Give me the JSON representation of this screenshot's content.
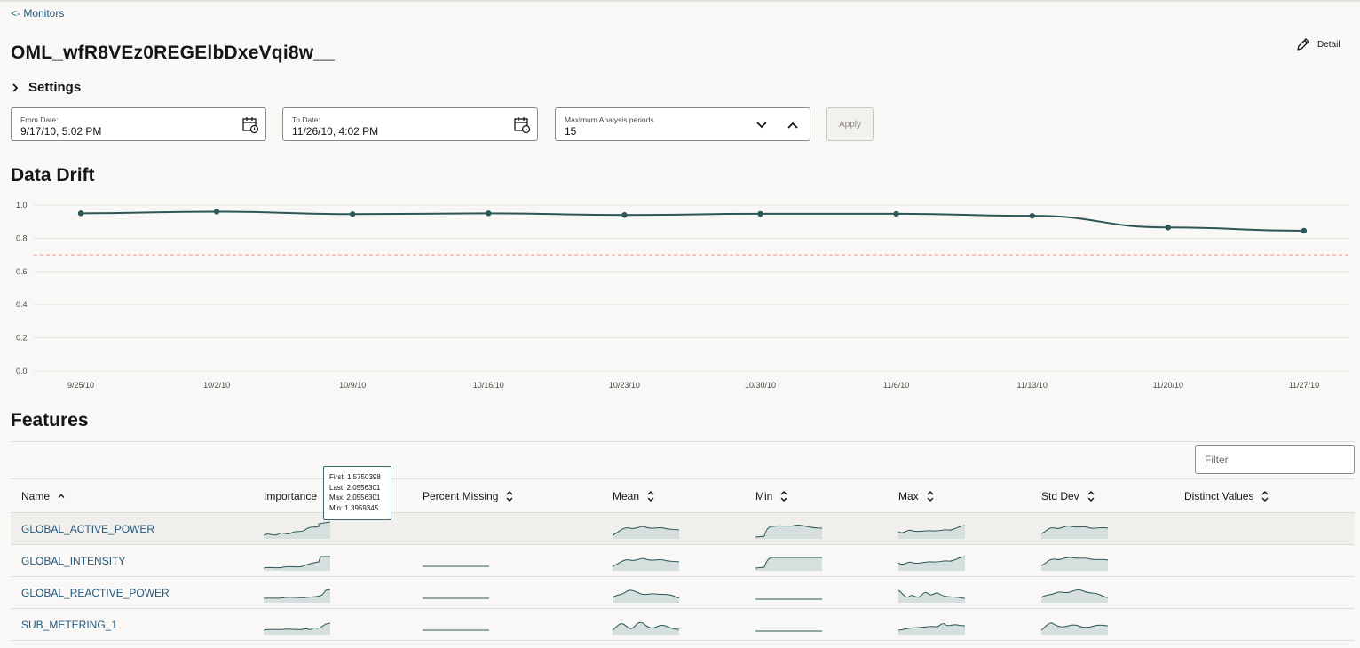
{
  "nav": {
    "back_label": "<- Monitors"
  },
  "page": {
    "title": "OML_wfR8VEz0REGElbDxeVqi8w__",
    "detail_label": "Detail"
  },
  "settings": {
    "label": "Settings",
    "from_date": {
      "label": "From Date:",
      "value": "9/17/10, 5:02 PM"
    },
    "to_date": {
      "label": "To Date:",
      "value": "11/26/10, 4:02 PM"
    },
    "max_periods": {
      "label": "Maximum Analysis periods",
      "value": "15"
    },
    "apply_label": "Apply"
  },
  "drift": {
    "title": "Data Drift"
  },
  "chart_data": {
    "type": "line",
    "title": "",
    "x": [
      "9/25/10",
      "10/2/10",
      "10/9/10",
      "10/16/10",
      "10/23/10",
      "10/30/10",
      "11/6/10",
      "11/13/10",
      "11/20/10",
      "11/27/10"
    ],
    "values": [
      0.95,
      0.96,
      0.945,
      0.95,
      0.94,
      0.947,
      0.947,
      0.935,
      0.865,
      0.845
    ],
    "y_ticks": [
      "0.0",
      "0.2",
      "0.4",
      "0.6",
      "0.8",
      "1.0"
    ],
    "ylim": [
      0,
      1
    ],
    "threshold": 0.7,
    "grid": true,
    "line_color": "#2b5757",
    "threshold_color": "#f4a9a0"
  },
  "features": {
    "title": "Features",
    "filter_placeholder": "Filter",
    "columns": [
      "Name",
      "Importance",
      "Percent Missing",
      "Mean",
      "Min",
      "Max",
      "Std Dev",
      "Distinct Values"
    ],
    "rows": [
      {
        "name": "GLOBAL_ACTIVE_POWER"
      },
      {
        "name": "GLOBAL_INTENSITY"
      },
      {
        "name": "GLOBAL_REACTIVE_POWER"
      },
      {
        "name": "SUB_METERING_1"
      }
    ],
    "tooltip": {
      "first": "First: 1.5750398",
      "last": "Last: 2.0556301",
      "max": "Max: 2.0556301",
      "min": "Min: 1.3959345"
    }
  }
}
